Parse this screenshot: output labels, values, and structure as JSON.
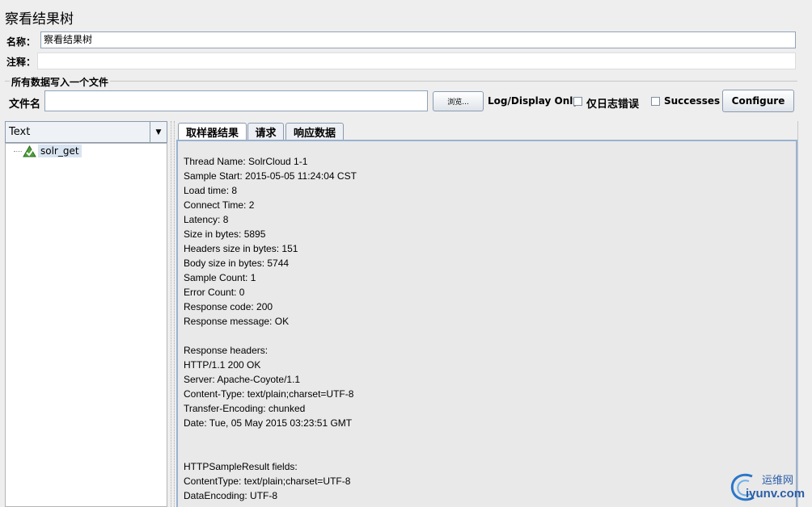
{
  "header": {
    "title": "察看结果树"
  },
  "name_row": {
    "label": "名称：",
    "value": "察看结果树"
  },
  "comment_row": {
    "label": "注释：",
    "value": ""
  },
  "file_section": {
    "title": "所有数据写入一个文件",
    "file_label": "文件名",
    "file_value": "",
    "browse_label": "浏览...",
    "log_display_label": "Log/Display Only:",
    "errors_only_label": "仅日志错误",
    "successes_label": "Successes",
    "configure_label": "Configure"
  },
  "left_panel": {
    "renderer_selected": "Text",
    "tree": [
      {
        "label": "solr_get",
        "icon": "sampler-success-icon"
      }
    ]
  },
  "tabs": [
    {
      "label": "取样器结果",
      "active": true
    },
    {
      "label": "请求",
      "active": false
    },
    {
      "label": "响应数据",
      "active": false
    }
  ],
  "sampler_result": [
    "Thread Name: SolrCloud 1-1",
    "Sample Start: 2015-05-05 11:24:04 CST",
    "Load time: 8",
    "Connect Time: 2",
    "Latency: 8",
    "Size in bytes: 5895",
    "Headers size in bytes: 151",
    "Body size in bytes: 5744",
    "Sample Count: 1",
    "Error Count: 0",
    "Response code: 200",
    "Response message: OK",
    "",
    "Response headers:",
    "HTTP/1.1 200 OK",
    "Server: Apache-Coyote/1.1",
    "Content-Type: text/plain;charset=UTF-8",
    "Transfer-Encoding: chunked",
    "Date: Tue, 05 May 2015 03:23:51 GMT",
    "",
    "",
    "HTTPSampleResult fields:",
    "ContentType: text/plain;charset=UTF-8",
    "DataEncoding: UTF-8"
  ],
  "watermark": {
    "cn": "运维网",
    "en": "iyunv.com"
  }
}
